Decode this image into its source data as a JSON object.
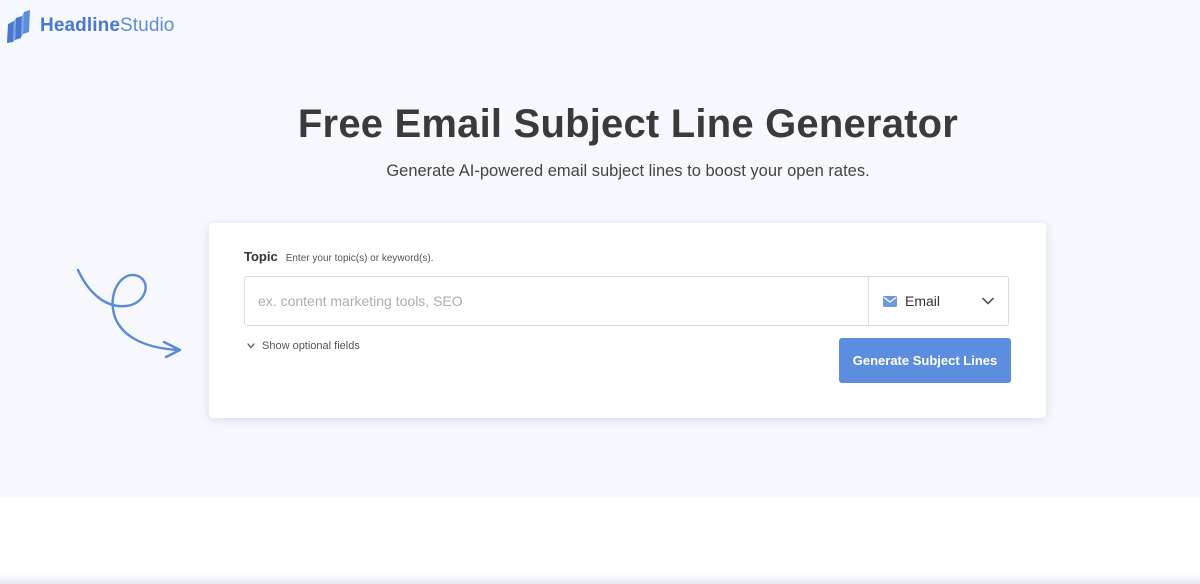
{
  "brand": {
    "logo_icon": "headlinestudio-logo-icon",
    "name_bold": "Headline",
    "name_light": "Studio",
    "color": "#4a78d0"
  },
  "hero": {
    "title": "Free Email Subject Line Generator",
    "subtitle": "Generate AI-powered email subject lines to boost your open rates.",
    "background": "#f6f8fd"
  },
  "form": {
    "topic_label": "Topic",
    "topic_hint": "Enter your topic(s) or keyword(s).",
    "topic_value": "",
    "topic_placeholder": "ex. content marketing tools, SEO",
    "type_select": {
      "icon": "envelope-icon",
      "selected": "Email",
      "chevron": "chevron-down-icon"
    },
    "optional_toggle": {
      "icon": "chevron-down-icon",
      "label": "Show optional fields"
    },
    "submit_label": "Generate Subject Lines",
    "accent_color": "#5d8ddf"
  },
  "decor": {
    "arrow_icon": "curly-arrow-icon"
  }
}
